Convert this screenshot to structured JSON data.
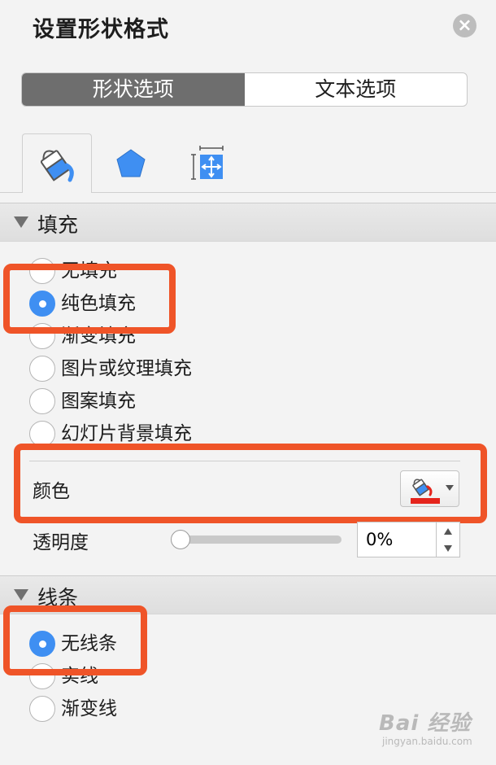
{
  "panel": {
    "title": "设置形状格式"
  },
  "tabs_segment": {
    "shape_options": "形状选项",
    "text_options": "文本选项"
  },
  "icon_tabs": [
    "fill-line-icon",
    "effects-pentagon-icon",
    "size-properties-icon"
  ],
  "fill_section": {
    "header": "填充",
    "options": [
      {
        "label": "无填充",
        "selected": false
      },
      {
        "label": "纯色填充",
        "selected": true
      },
      {
        "label": "渐变填充",
        "selected": false
      },
      {
        "label": "图片或纹理填充",
        "selected": false
      },
      {
        "label": "图案填充",
        "selected": false
      },
      {
        "label": "幻灯片背景填充",
        "selected": false
      }
    ],
    "color_label": "颜色",
    "color_value": "#e5241c",
    "transparency_label": "透明度",
    "transparency_value": "0%",
    "transparency_fraction": 0
  },
  "line_section": {
    "header": "线条",
    "options": [
      {
        "label": "无线条",
        "selected": true
      },
      {
        "label": "实线",
        "selected": false
      },
      {
        "label": "渐变线",
        "selected": false
      }
    ]
  },
  "colors": {
    "accent": "#3f8ff2",
    "highlight": "#ef5428",
    "tab_active": "#6e6e6e"
  },
  "watermark": {
    "logo_text": "Bai 经验",
    "url": "jingyan.baidu.com"
  }
}
